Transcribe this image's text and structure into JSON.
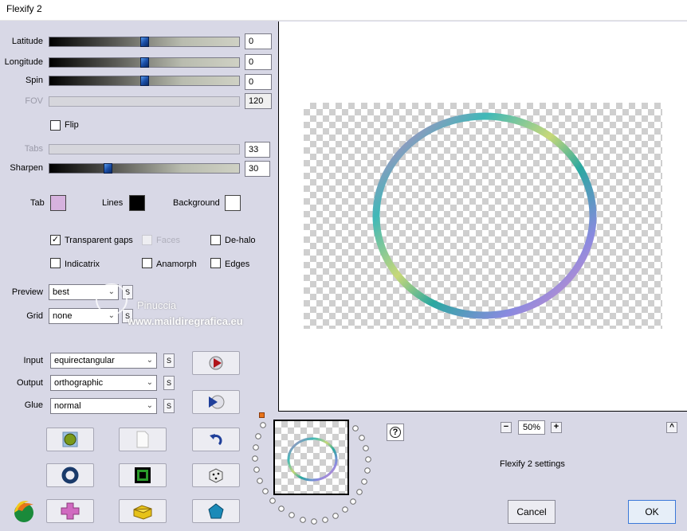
{
  "window": {
    "title": "Flexify 2"
  },
  "sliders": [
    {
      "label": "Latitude",
      "value": "0",
      "thumb": 0.5,
      "enabled": true
    },
    {
      "label": "Longitude",
      "value": "0",
      "thumb": 0.5,
      "enabled": true
    },
    {
      "label": "Spin",
      "value": "0",
      "thumb": 0.5,
      "enabled": true
    },
    {
      "label": "FOV",
      "value": "120",
      "enabled": false
    },
    {
      "label": "Tabs",
      "value": "33",
      "enabled": false
    },
    {
      "label": "Sharpen",
      "value": "30",
      "thumb": 0.3,
      "enabled": true
    }
  ],
  "flip": {
    "label": "Flip",
    "checked": false
  },
  "colors": {
    "tab_label": "Tab",
    "tab_color": "#d6b2de",
    "lines_label": "Lines",
    "lines_color": "#000000",
    "background_label": "Background",
    "background_color": "#ffffff"
  },
  "options": {
    "transparent_gaps": {
      "label": "Transparent gaps",
      "checked": true
    },
    "faces": {
      "label": "Faces",
      "checked": false,
      "enabled": false
    },
    "de_halo": {
      "label": "De-halo",
      "checked": false
    },
    "indicatrix": {
      "label": "Indicatrix",
      "checked": false
    },
    "anamorph": {
      "label": "Anamorph",
      "checked": false
    },
    "edges": {
      "label": "Edges",
      "checked": false
    }
  },
  "preview_combo": {
    "label": "Preview",
    "value": "best"
  },
  "grid_combo": {
    "label": "Grid",
    "value": "none"
  },
  "input_combo": {
    "label": "Input",
    "value": "equirectangular"
  },
  "output_combo": {
    "label": "Output",
    "value": "orthographic"
  },
  "glue_combo": {
    "label": "Glue",
    "value": "normal"
  },
  "s_label": "S",
  "watermark": {
    "line1": "Pinuccia",
    "line2": "www.maildiregrafica.eu"
  },
  "zoom": {
    "minus": "−",
    "value": "50%",
    "plus": "+"
  },
  "up_arrow": "^",
  "help": "?",
  "status": "Flexify 2 settings",
  "buttons": {
    "cancel": "Cancel",
    "ok": "OK"
  }
}
